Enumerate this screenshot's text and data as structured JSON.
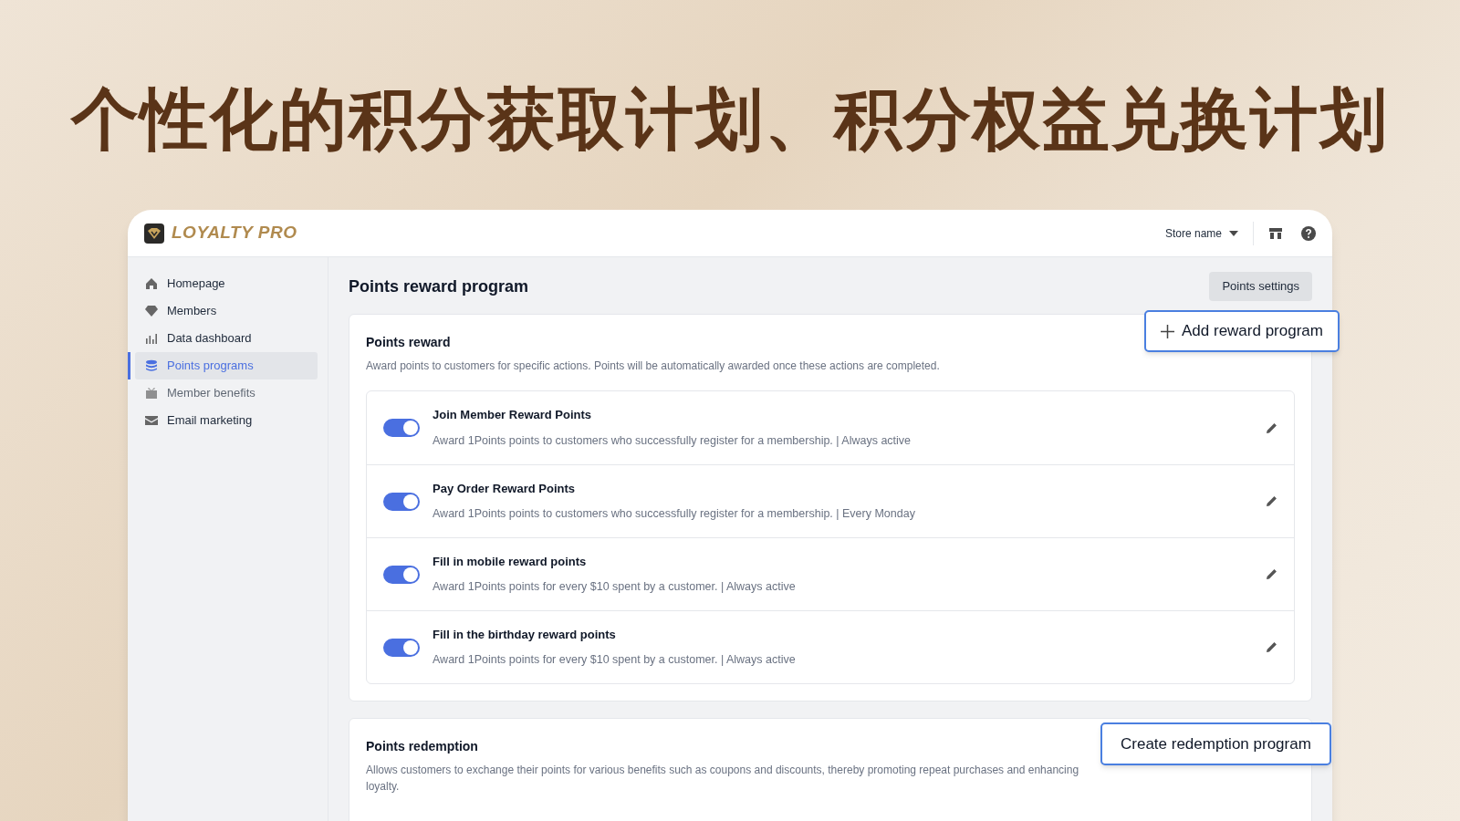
{
  "headline": "个性化的积分获取计划、积分权益兑换计划",
  "app": {
    "logo_text": "LOYALTY PRO",
    "store_selector": "Store name"
  },
  "sidebar": {
    "items": [
      {
        "label": "Homepage",
        "kind": "home",
        "selected": false,
        "disabled": false
      },
      {
        "label": "Members",
        "kind": "diamond",
        "selected": false,
        "disabled": false
      },
      {
        "label": "Data dashboard",
        "kind": "chart",
        "selected": false,
        "disabled": false
      },
      {
        "label": "Points programs",
        "kind": "stack",
        "selected": true,
        "disabled": false
      },
      {
        "label": "Member benefits",
        "kind": "gift",
        "selected": false,
        "disabled": true
      },
      {
        "label": "Email marketing",
        "kind": "mail",
        "selected": false,
        "disabled": false
      }
    ]
  },
  "page": {
    "title": "Points reward program",
    "settings_button": "Points settings"
  },
  "reward_card": {
    "title": "Points reward",
    "description": "Award points to customers for specific actions. Points will be automatically awarded once these actions are completed.",
    "floating_button": "Add reward program",
    "rows": [
      {
        "title": "Join Member Reward Points",
        "description": "Award 1Points points to customers who successfully register for a membership. | Always active",
        "on": true
      },
      {
        "title": "Pay Order Reward Points",
        "description": "Award 1Points points to customers who successfully register for a membership. | Every Monday",
        "on": true
      },
      {
        "title": "Fill in mobile reward points",
        "description": "Award 1Points points for every $10 spent by a customer. | Always active",
        "on": true
      },
      {
        "title": "Fill in the birthday reward points",
        "description": "Award 1Points points for every $10 spent by a customer. | Always active",
        "on": true
      }
    ]
  },
  "redemption_card": {
    "title": "Points redemption",
    "description": "Allows customers to exchange their points for various benefits such as coupons and discounts, thereby promoting repeat purchases and enhancing loyalty.",
    "floating_button": "Create redemption program"
  }
}
